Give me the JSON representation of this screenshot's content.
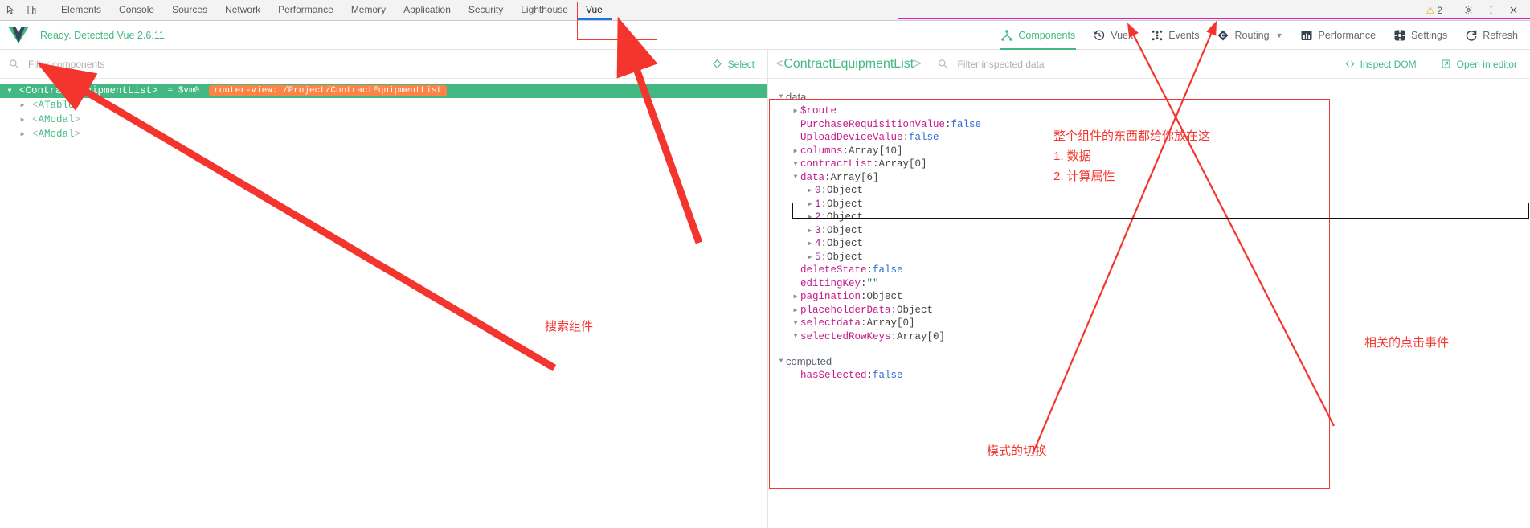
{
  "devtools": {
    "icons": {
      "inspect": "inspect-element-icon",
      "device": "device-toolbar-icon"
    },
    "tabs": [
      {
        "label": "Elements",
        "active": false
      },
      {
        "label": "Console",
        "active": false
      },
      {
        "label": "Sources",
        "active": false
      },
      {
        "label": "Network",
        "active": false
      },
      {
        "label": "Performance",
        "active": false
      },
      {
        "label": "Memory",
        "active": false
      },
      {
        "label": "Application",
        "active": false
      },
      {
        "label": "Security",
        "active": false
      },
      {
        "label": "Lighthouse",
        "active": false
      },
      {
        "label": "Vue",
        "active": true
      }
    ],
    "warning_count": "2",
    "right_icons": [
      "warning-icon",
      "settings-gear-icon",
      "more-vertical-icon",
      "close-icon"
    ]
  },
  "vue_header": {
    "status": "Ready. Detected Vue 2.6.11.",
    "nav": [
      {
        "label": "Components",
        "icon": "components-tree-icon",
        "active": true,
        "chevron": false
      },
      {
        "label": "Vuex",
        "icon": "vuex-clock-icon",
        "active": false,
        "chevron": false
      },
      {
        "label": "Events",
        "icon": "events-dots-icon",
        "active": false,
        "chevron": false
      },
      {
        "label": "Routing",
        "icon": "routing-diamond-icon",
        "active": false,
        "chevron": true
      },
      {
        "label": "Performance",
        "icon": "performance-bars-icon",
        "active": false,
        "chevron": false
      },
      {
        "label": "Settings",
        "icon": "settings-gear-icon",
        "active": false,
        "chevron": false
      },
      {
        "label": "Refresh",
        "icon": "refresh-icon",
        "active": false,
        "chevron": false
      }
    ]
  },
  "left_pane": {
    "search_placeholder": "Filter components",
    "search_value": "",
    "search_icon": "search-icon",
    "select_button": {
      "label": "Select",
      "icon": "select-target-icon"
    },
    "tree": [
      {
        "depth": 0,
        "caret": "down",
        "tag": "ContractEquipmentList",
        "vm": "= $vm0",
        "badge": "router-view: /Project/ContractEquipmentList",
        "selected": true
      },
      {
        "depth": 1,
        "caret": "right",
        "tag": "ATable",
        "vm": "",
        "badge": "",
        "selected": false
      },
      {
        "depth": 1,
        "caret": "right",
        "tag": "AModal",
        "vm": "",
        "badge": "",
        "selected": false
      },
      {
        "depth": 1,
        "caret": "right",
        "tag": "AModal",
        "vm": "",
        "badge": "",
        "selected": false
      }
    ]
  },
  "right_pane": {
    "component_name": "ContractEquipmentList",
    "search_placeholder": "Filter inspected data",
    "search_value": "",
    "search_icon": "search-icon",
    "inspect_dom": {
      "label": "Inspect DOM",
      "icon": "code-brackets-icon"
    },
    "open_in_editor": {
      "label": "Open in editor",
      "icon": "external-link-icon"
    },
    "groups": [
      {
        "name": "data",
        "caret": "down",
        "rows": [
          {
            "indent": 1,
            "caret": "right",
            "key": "$route",
            "key_kind": "prop",
            "value": "",
            "value_kind": "none",
            "highlight": false
          },
          {
            "indent": 1,
            "caret": "none",
            "key": "PurchaseRequisitionValue",
            "key_kind": "prop",
            "value": "false",
            "value_kind": "bool",
            "highlight": false
          },
          {
            "indent": 1,
            "caret": "none",
            "key": "UploadDeviceValue",
            "key_kind": "prop",
            "value": "false",
            "value_kind": "bool",
            "highlight": false
          },
          {
            "indent": 1,
            "caret": "right",
            "key": "columns",
            "key_kind": "prop",
            "value": "Array[10]",
            "value_kind": "obj",
            "highlight": false
          },
          {
            "indent": 1,
            "caret": "down",
            "key": "contractList",
            "key_kind": "prop",
            "value": "Array[0]",
            "value_kind": "obj",
            "highlight": false
          },
          {
            "indent": 1,
            "caret": "down",
            "key": "data",
            "key_kind": "prop",
            "value": "Array[6]",
            "value_kind": "obj",
            "highlight": true
          },
          {
            "indent": 2,
            "caret": "right",
            "key": "0",
            "key_kind": "idx",
            "value": "Object",
            "value_kind": "obj",
            "highlight": false
          },
          {
            "indent": 2,
            "caret": "right",
            "key": "1",
            "key_kind": "idx",
            "value": "Object",
            "value_kind": "obj",
            "highlight": false
          },
          {
            "indent": 2,
            "caret": "right",
            "key": "2",
            "key_kind": "idx",
            "value": "Object",
            "value_kind": "obj",
            "highlight": false
          },
          {
            "indent": 2,
            "caret": "right",
            "key": "3",
            "key_kind": "idx",
            "value": "Object",
            "value_kind": "obj",
            "highlight": false
          },
          {
            "indent": 2,
            "caret": "right",
            "key": "4",
            "key_kind": "idx",
            "value": "Object",
            "value_kind": "obj",
            "highlight": false
          },
          {
            "indent": 2,
            "caret": "right",
            "key": "5",
            "key_kind": "idx",
            "value": "Object",
            "value_kind": "obj",
            "highlight": false
          },
          {
            "indent": 1,
            "caret": "none",
            "key": "deleteState",
            "key_kind": "prop",
            "value": "false",
            "value_kind": "bool",
            "highlight": false
          },
          {
            "indent": 1,
            "caret": "none",
            "key": "editingKey",
            "key_kind": "prop",
            "value": "\"\"",
            "value_kind": "str",
            "highlight": false
          },
          {
            "indent": 1,
            "caret": "right",
            "key": "pagination",
            "key_kind": "prop",
            "value": "Object",
            "value_kind": "obj",
            "highlight": false
          },
          {
            "indent": 1,
            "caret": "right",
            "key": "placeholderData",
            "key_kind": "prop",
            "value": "Object",
            "value_kind": "obj",
            "highlight": false
          },
          {
            "indent": 1,
            "caret": "down",
            "key": "selectdata",
            "key_kind": "prop",
            "value": "Array[0]",
            "value_kind": "obj",
            "highlight": false
          },
          {
            "indent": 1,
            "caret": "down",
            "key": "selectedRowKeys",
            "key_kind": "prop",
            "value": "Array[0]",
            "value_kind": "obj",
            "highlight": false
          }
        ]
      },
      {
        "name": "computed",
        "caret": "down",
        "rows": [
          {
            "indent": 1,
            "caret": "none",
            "key": "hasSelected",
            "key_kind": "prop",
            "value": "false",
            "value_kind": "bool",
            "highlight": false
          }
        ]
      }
    ]
  },
  "annotations": {
    "search_components": "搜索组件",
    "component_contents": "整个组件的东西都给你放在这",
    "component_contents_1": "1. 数据",
    "component_contents_2": "2. 计算属性",
    "click_events": "相关的点击事件",
    "mode_switch": "模式的切换"
  },
  "colors": {
    "vue_green": "#42b983",
    "annotation_red": "#f4352e",
    "route_badge_orange": "#ff8344",
    "devtools_active_blue": "#1a73e8",
    "magenta_box": "#e617b9"
  }
}
